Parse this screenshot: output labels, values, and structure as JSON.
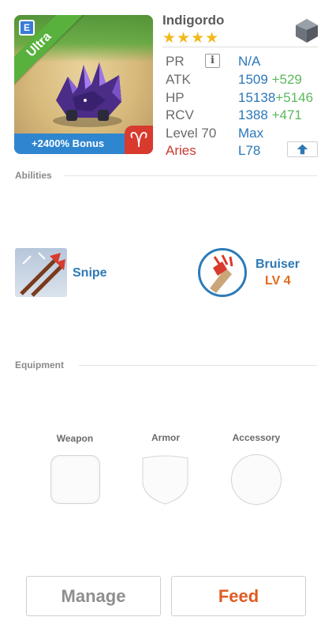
{
  "monster": {
    "name": "Indigordo",
    "stars": "★★★★",
    "rarity_ribbon": "Ultra",
    "element_glyph": "E",
    "bonus": "+2400% Bonus",
    "sign_glyph": "♈"
  },
  "stats": [
    {
      "label": "PR",
      "value": "N/A",
      "plus": ""
    },
    {
      "label": "ATK",
      "value": "1509",
      "plus": "+529"
    },
    {
      "label": "HP",
      "value": "15138",
      "plus": "+5146"
    },
    {
      "label": "RCV",
      "value": "1388",
      "plus": "+471"
    },
    {
      "label": "Level 70",
      "value": "Max",
      "plus": ""
    },
    {
      "label": "Aries",
      "value": "L78",
      "plus": ""
    }
  ],
  "sections": {
    "abilities": "Abilities",
    "equipment": "Equipment"
  },
  "abilities": [
    {
      "name": "Snipe",
      "level": ""
    },
    {
      "name": "Bruiser",
      "level": "LV 4"
    }
  ],
  "equipment": {
    "weapon": "Weapon",
    "armor": "Armor",
    "accessory": "Accessory"
  },
  "buttons": {
    "manage": "Manage",
    "feed": "Feed"
  },
  "colors": {
    "accent_blue": "#2e79b6",
    "plus_green": "#5cb85c",
    "aries_red": "#cc3a2f",
    "feed_orange": "#e05a21",
    "star_gold": "#f1b91a",
    "ultra_green": "#58b13d"
  },
  "icons": {
    "info": "info-icon",
    "gem": "gem-icon",
    "level_up": "arrow-up-icon"
  }
}
